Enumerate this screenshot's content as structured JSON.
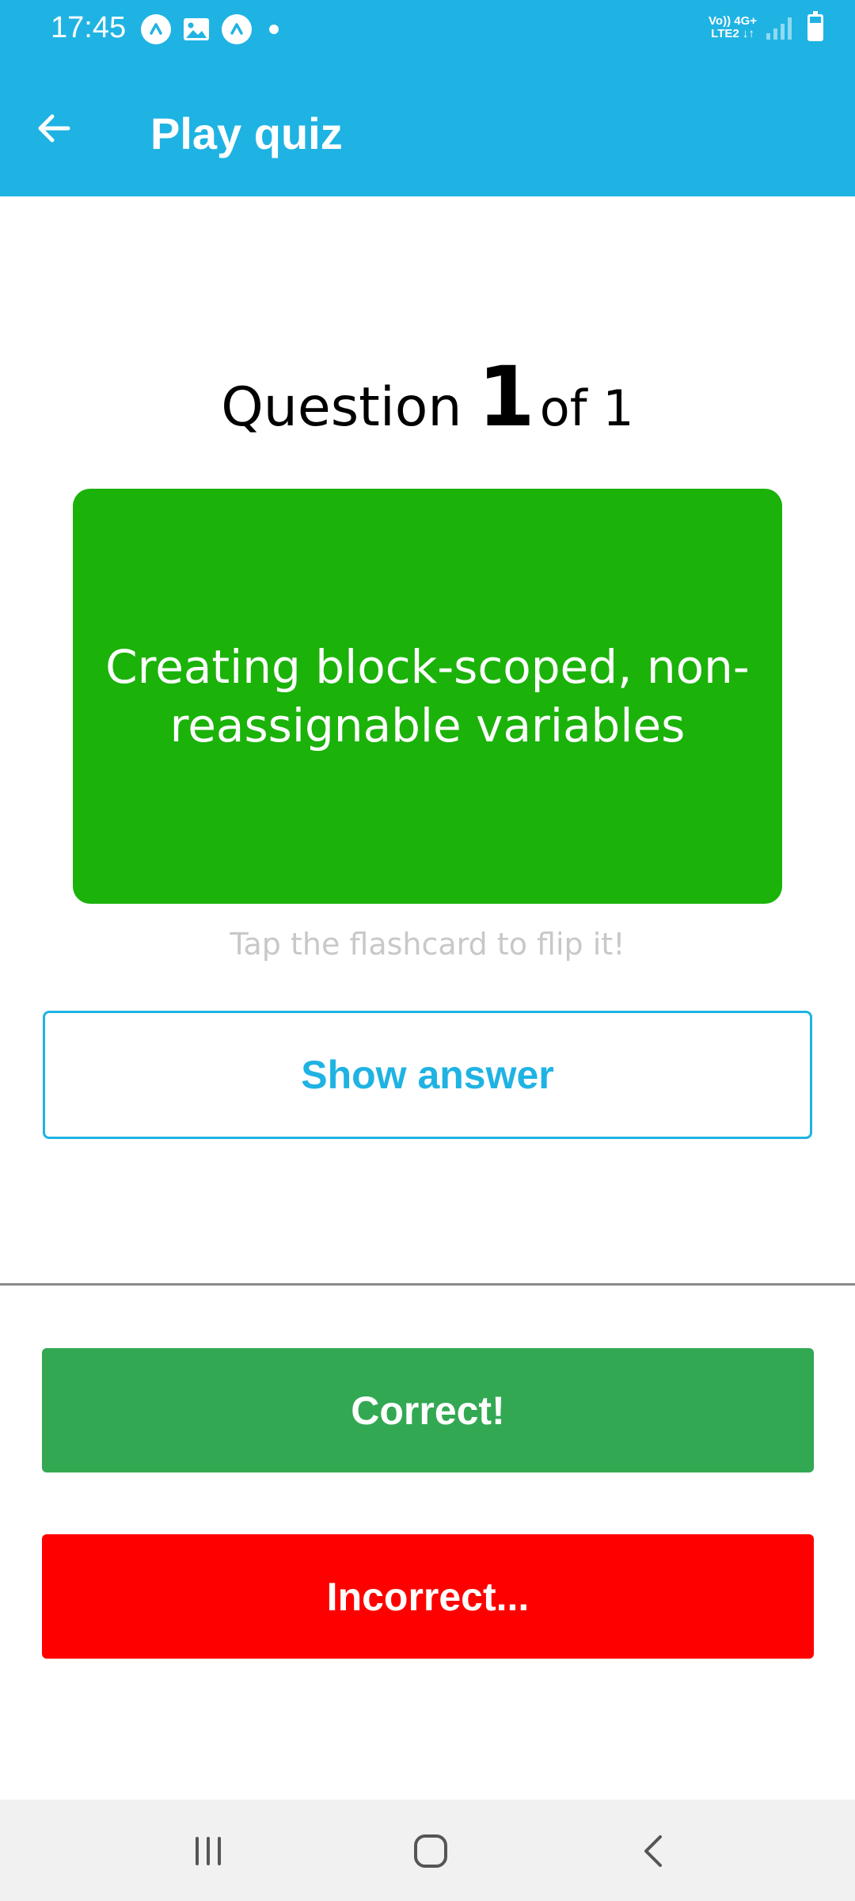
{
  "status_bar": {
    "time": "17:45",
    "network_top": "Vo)) 4G+",
    "network_bottom": "LTE2 ↓↑",
    "icons": [
      "app-notification-icon",
      "image-notification-icon",
      "app-notification-icon",
      "dot-icon",
      "signal-icon",
      "battery-icon"
    ]
  },
  "app_bar": {
    "title": "Play quiz",
    "back_icon": "arrow-left-icon"
  },
  "question": {
    "label": "Question",
    "current": "1",
    "of_text": "of 1"
  },
  "flashcard": {
    "text": "Creating block-scoped, non-reassignable variables"
  },
  "hint": "Tap the flashcard to flip it!",
  "show_answer_label": "Show answer",
  "correct_label": "Correct!",
  "incorrect_label": "Incorrect...",
  "colors": {
    "primary": "#1FB3E3",
    "card": "#1BB20A",
    "correct": "#33A853",
    "incorrect": "#FF0000"
  },
  "nav_bar": {
    "buttons": [
      "recent-apps-icon",
      "home-icon",
      "back-icon"
    ]
  }
}
